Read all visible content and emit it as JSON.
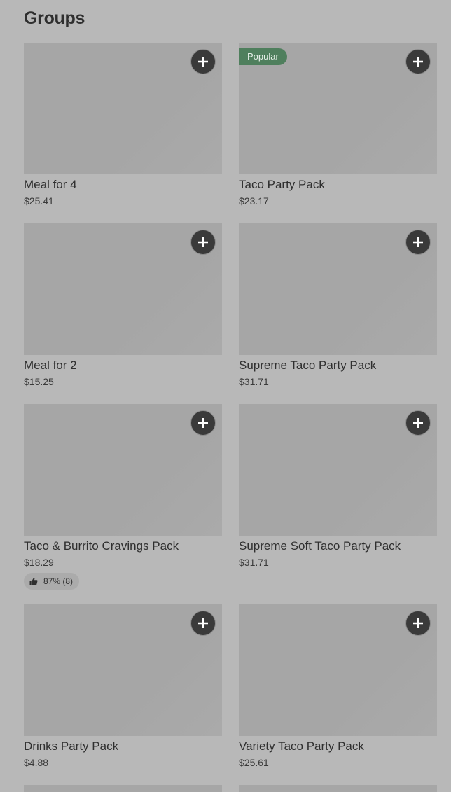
{
  "section": {
    "title": "Groups"
  },
  "items": [
    {
      "name": "Meal for 4",
      "price": "$25.41",
      "badge": ""
    },
    {
      "name": "Taco Party Pack",
      "price": "$23.17",
      "badge": "Popular"
    },
    {
      "name": "Meal for 2",
      "price": "$15.25",
      "badge": ""
    },
    {
      "name": "Supreme Taco Party Pack",
      "price": "$31.71",
      "badge": ""
    },
    {
      "name": "Taco & Burrito Cravings Pack",
      "price": "$18.29",
      "badge": "",
      "rating": "87% (8)"
    },
    {
      "name": "Supreme Soft Taco Party Pack",
      "price": "$31.71",
      "badge": ""
    },
    {
      "name": "Drinks Party Pack",
      "price": "$4.88",
      "badge": ""
    },
    {
      "name": "Variety Taco Party Pack",
      "price": "$25.61",
      "badge": ""
    }
  ],
  "icons": {
    "add": "plus-icon",
    "rating": "thumbs-up-icon"
  },
  "colors": {
    "background": "#b8b8b8",
    "image_placeholder": "#a6a6a6",
    "add_button": "#3a3a3a",
    "badge": "#4f7f5d"
  }
}
